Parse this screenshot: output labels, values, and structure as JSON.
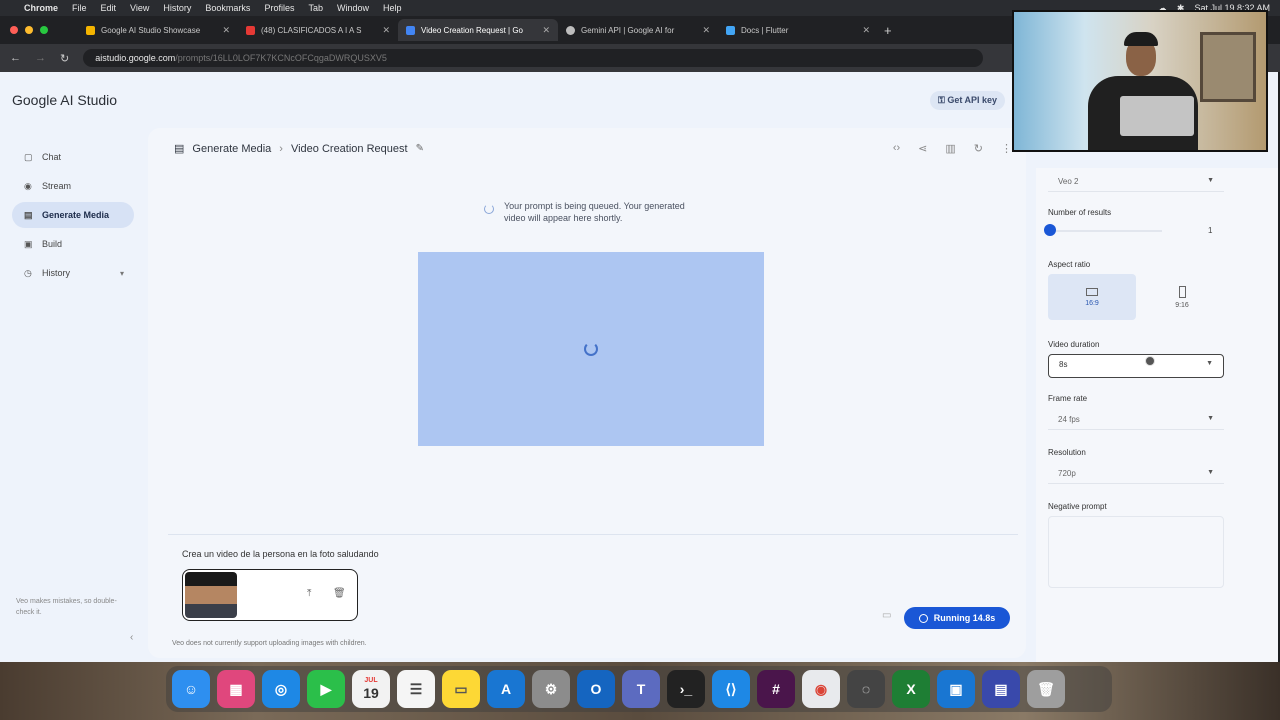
{
  "menubar": {
    "app": "Chrome",
    "items": [
      "File",
      "Edit",
      "View",
      "History",
      "Bookmarks",
      "Profiles",
      "Tab",
      "Window",
      "Help"
    ],
    "clock": "Sat Jul 19 8:32 AM"
  },
  "browser": {
    "tabs": [
      {
        "title": "Google AI Studio Showcase",
        "color": "#f4b400"
      },
      {
        "title": "(48) CLASIFICADOS A I A S",
        "color": "#e53935"
      },
      {
        "title": "Video Creation Request | Go",
        "color": "#4285f4"
      },
      {
        "title": "Gemini API | Google AI for",
        "color": "#bdbdbd"
      },
      {
        "title": "Docs | Flutter",
        "color": "#42a5f5"
      }
    ],
    "url_host": "aistudio.google.com",
    "url_path": "/prompts/16LL0LOF7K7KCNcOFCqgaDWRQUSXV5"
  },
  "app": {
    "logo": "Google AI Studio",
    "api_key_label": "Get API key",
    "nav": [
      {
        "label": "Chat",
        "icon": "chat-icon"
      },
      {
        "label": "Stream",
        "icon": "stream-icon"
      },
      {
        "label": "Generate Media",
        "icon": "media-icon"
      },
      {
        "label": "Build",
        "icon": "build-icon"
      },
      {
        "label": "History",
        "icon": "history-icon"
      }
    ],
    "sidebar_footer": "Veo makes mistakes, so double-check it."
  },
  "main": {
    "breadcrumb_root": "Generate Media",
    "breadcrumb_current": "Video Creation Request",
    "queue_message": "Your prompt is being queued. Your generated video will appear here shortly.",
    "prompt_text": "Crea un video de la persona en la foto saludando",
    "run_label": "Running 14.8s",
    "footer_note": "Veo does not currently support uploading images with children."
  },
  "settings": {
    "model": "Veo 2",
    "number_of_results_label": "Number of results",
    "number_of_results_value": "1",
    "aspect_ratio_label": "Aspect ratio",
    "aspect_16_9": "16:9",
    "aspect_9_16": "9:16",
    "video_duration_label": "Video duration",
    "video_duration_value": "8s",
    "frame_rate_label": "Frame rate",
    "frame_rate_value": "24 fps",
    "resolution_label": "Resolution",
    "resolution_value": "720p",
    "negative_prompt_label": "Negative prompt"
  },
  "calendar": {
    "day": "19",
    "month": "JUL"
  },
  "colors": {
    "accent": "#1a57d6",
    "placeholder_bg": "#adc6f2",
    "active_nav": "#d7e2f5"
  }
}
